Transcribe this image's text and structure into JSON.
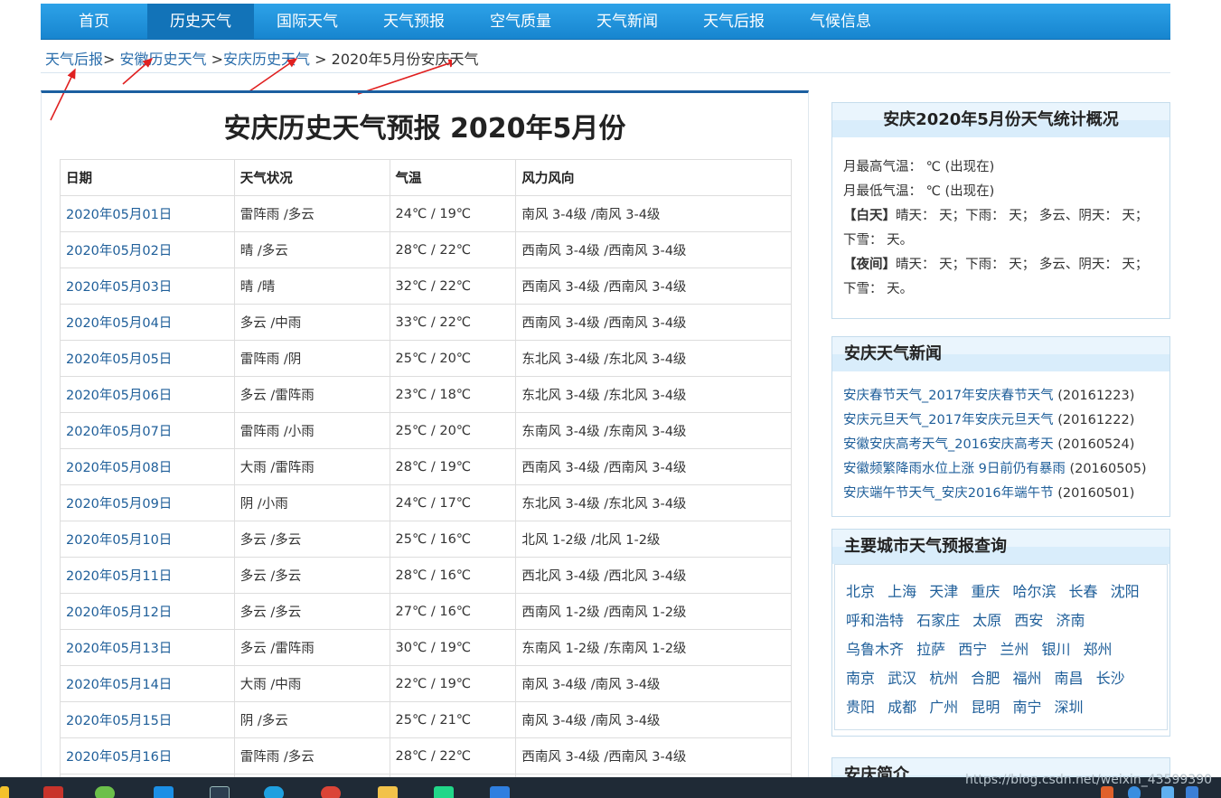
{
  "nav": [
    {
      "label": "首页",
      "active": false
    },
    {
      "label": "历史天气",
      "active": true
    },
    {
      "label": "国际天气",
      "active": false
    },
    {
      "label": "天气预报",
      "active": false
    },
    {
      "label": "空气质量",
      "active": false
    },
    {
      "label": "天气新闻",
      "active": false
    },
    {
      "label": "天气后报",
      "active": false
    },
    {
      "label": "气候信息",
      "active": false
    }
  ],
  "breadcrumb": {
    "crumb1": "天气后报",
    "sep1": ">",
    "crumb2": "安徽历史天气",
    "sep2": ">",
    "crumb3": "安庆历史天气",
    "sep3": ">",
    "current": "2020年5月份安庆天气"
  },
  "main": {
    "title": "安庆历史天气预报 2020年5月份",
    "headers": [
      "日期",
      "天气状况",
      "气温",
      "风力风向"
    ],
    "rows": [
      [
        "2020年05月01日",
        "雷阵雨 /多云",
        "24℃ / 19℃",
        "南风 3-4级 /南风 3-4级"
      ],
      [
        "2020年05月02日",
        "晴 /多云",
        "28℃ / 22℃",
        "西南风 3-4级 /西南风 3-4级"
      ],
      [
        "2020年05月03日",
        "晴 /晴",
        "32℃ / 22℃",
        "西南风 3-4级 /西南风 3-4级"
      ],
      [
        "2020年05月04日",
        "多云 /中雨",
        "33℃ / 22℃",
        "西南风 3-4级 /西南风 3-4级"
      ],
      [
        "2020年05月05日",
        "雷阵雨 /阴",
        "25℃ / 20℃",
        "东北风 3-4级 /东北风 3-4级"
      ],
      [
        "2020年05月06日",
        "多云 /雷阵雨",
        "23℃ / 18℃",
        "东北风 3-4级 /东北风 3-4级"
      ],
      [
        "2020年05月07日",
        "雷阵雨 /小雨",
        "25℃ / 20℃",
        "东南风 3-4级 /东南风 3-4级"
      ],
      [
        "2020年05月08日",
        "大雨 /雷阵雨",
        "28℃ / 19℃",
        "西南风 3-4级 /西南风 3-4级"
      ],
      [
        "2020年05月09日",
        "阴 /小雨",
        "24℃ / 17℃",
        "东北风 3-4级 /东北风 3-4级"
      ],
      [
        "2020年05月10日",
        "多云 /多云",
        "25℃ / 16℃",
        "北风 1-2级 /北风 1-2级"
      ],
      [
        "2020年05月11日",
        "多云 /多云",
        "28℃ / 16℃",
        "西北风 3-4级 /西北风 3-4级"
      ],
      [
        "2020年05月12日",
        "多云 /多云",
        "27℃ / 16℃",
        "西南风 1-2级 /西南风 1-2级"
      ],
      [
        "2020年05月13日",
        "多云 /雷阵雨",
        "30℃ / 19℃",
        "东南风 1-2级 /东南风 1-2级"
      ],
      [
        "2020年05月14日",
        "大雨 /中雨",
        "22℃ / 19℃",
        "南风 3-4级 /南风 3-4级"
      ],
      [
        "2020年05月15日",
        "阴 /多云",
        "25℃ / 21℃",
        "南风 3-4级 /南风 3-4级"
      ],
      [
        "2020年05月16日",
        "雷阵雨 /多云",
        "28℃ / 22℃",
        "西南风 3-4级 /西南风 3-4级"
      ],
      [
        "",
        "",
        "",
        ""
      ]
    ]
  },
  "stats": {
    "title": "安庆2020年5月份天气统计概况",
    "max_temp": "月最高气温：  ℃ (出现在)",
    "min_temp": "月最低气温：  ℃ (出现在)",
    "day_label": "【白天】",
    "day_text": "晴天：  天；下雨：  天；  多云、阴天：  天；下雪：  天。",
    "night_label": "【夜间】",
    "night_text": "晴天：  天；下雨：  天；  多云、阴天：  天；下雪：  天。"
  },
  "news": {
    "title": "安庆天气新闻",
    "items": [
      {
        "text": "安庆春节天气_2017年安庆春节天气",
        "date": "(20161223)"
      },
      {
        "text": "安庆元旦天气_2017年安庆元旦天气",
        "date": "(20161222)"
      },
      {
        "text": "安徽安庆高考天气_2016安庆高考天",
        "date": "(20160524)"
      },
      {
        "text": "安徽频繁降雨水位上涨 9日前仍有暴雨",
        "date": "(20160505)"
      },
      {
        "text": "安庆端午节天气_安庆2016年端午节",
        "date": "(20160501)"
      }
    ]
  },
  "cities": {
    "title": "主要城市天气预报查询",
    "list": [
      "北京",
      "上海",
      "天津",
      "重庆",
      "哈尔滨",
      "长春",
      "沈阳",
      "呼和浩特",
      "石家庄",
      "太原",
      "西安",
      "济南",
      "乌鲁木齐",
      "拉萨",
      "西宁",
      "兰州",
      "银川",
      "郑州",
      "南京",
      "武汉",
      "杭州",
      "合肥",
      "福州",
      "南昌",
      "长沙",
      "贵阳",
      "成都",
      "广州",
      "昆明",
      "南宁",
      "深圳"
    ]
  },
  "intro": {
    "title": "安庆简介"
  },
  "watermark": "https://blog.csdn.net/weixin_43599390",
  "colors": {
    "nav_blue": "#1785cf",
    "link_blue": "#1e5e99",
    "arrow_red": "#e02020"
  }
}
